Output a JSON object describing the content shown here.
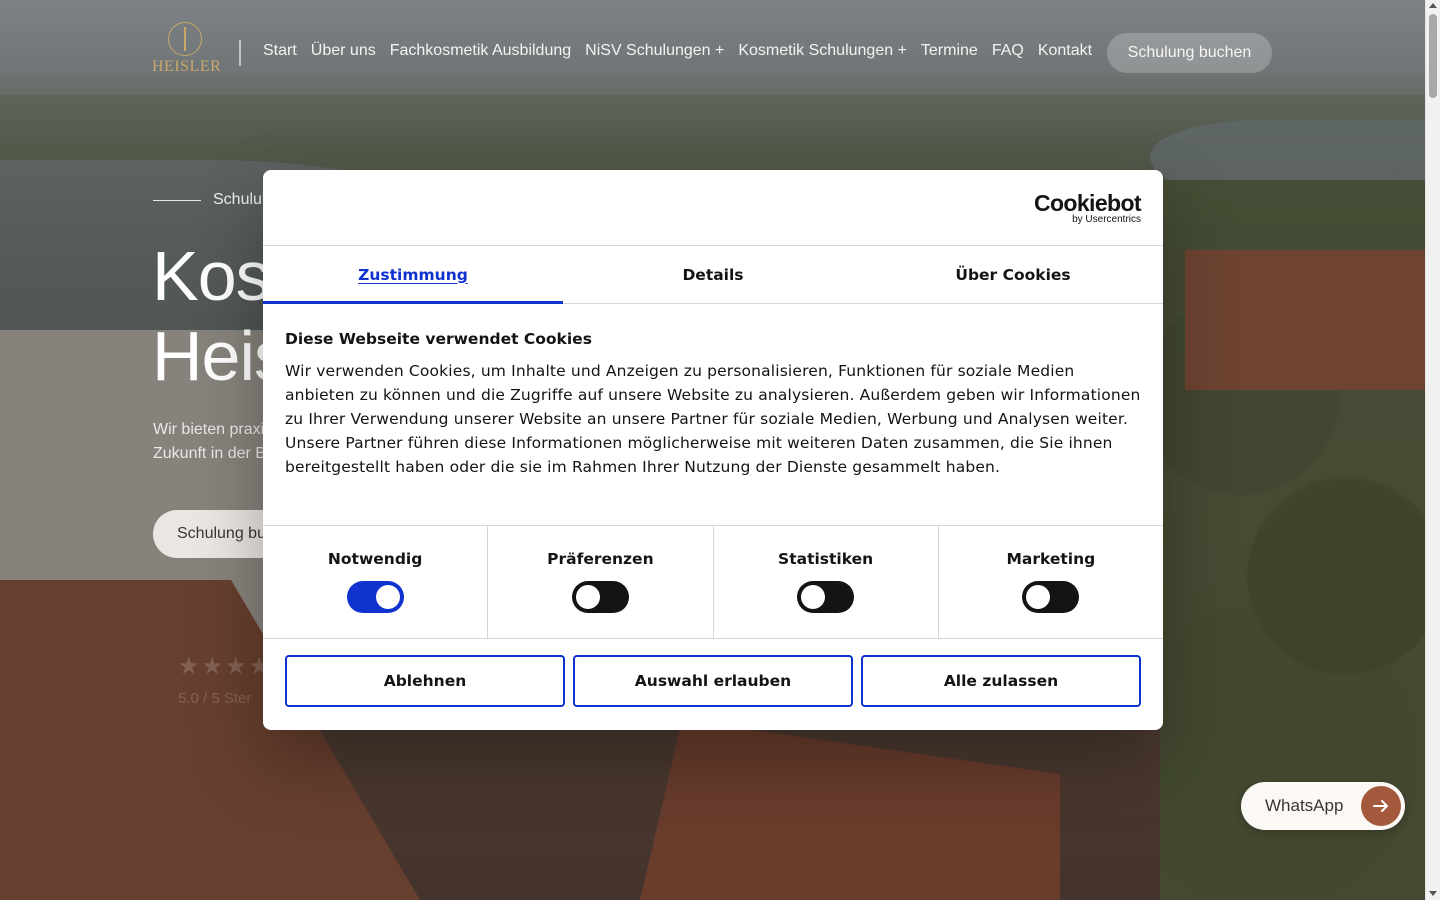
{
  "header": {
    "logo_text": "HEISLER",
    "nav": [
      "Start",
      "Über uns",
      "Fachkosmetik Ausbildung",
      "NiSV Schulungen +",
      "Kosmetik Schulungen +",
      "Termine",
      "FAQ",
      "Kontakt"
    ],
    "cta": "Schulung buchen"
  },
  "hero": {
    "eyebrow": "Schulun",
    "title_line1": "Kos",
    "title_line2": "Heis",
    "subtitle_line1": "Wir bieten praxi",
    "subtitle_line2": "Zukunft in der B",
    "cta": "Schulung bu",
    "stars": "★★★★",
    "rating": "5.0 / 5 Ster"
  },
  "whatsapp": {
    "label": "WhatsApp"
  },
  "cookie": {
    "brand": "Cookiebot",
    "brand_by": "by Usercentrics",
    "tabs": [
      "Zustimmung",
      "Details",
      "Über Cookies"
    ],
    "active_tab": "Zustimmung",
    "title": "Diese Webseite verwendet Cookies",
    "text": "Wir verwenden Cookies, um Inhalte und Anzeigen zu personalisieren, Funktionen für soziale Medien anbieten zu können und die Zugriffe auf unsere Website zu analysieren. Außerdem geben wir Informationen zu Ihrer Verwendung unserer Website an unsere Partner für soziale Medien, Werbung und Analysen weiter. Unsere Partner führen diese Informationen möglicherweise mit weiteren Daten zusammen, die Sie ihnen bereitgestellt haben oder die sie im Rahmen Ihrer Nutzung der Dienste gesammelt haben.",
    "toggles": [
      {
        "label": "Notwendig",
        "on": true
      },
      {
        "label": "Präferenzen",
        "on": false
      },
      {
        "label": "Statistiken",
        "on": false
      },
      {
        "label": "Marketing",
        "on": false
      }
    ],
    "buttons": [
      "Ablehnen",
      "Auswahl erlauben",
      "Alle zulassen"
    ]
  },
  "colors": {
    "accent": "#1032cf",
    "logo_gold": "#c9a96a",
    "whatsapp_arrow": "#a4593c"
  }
}
